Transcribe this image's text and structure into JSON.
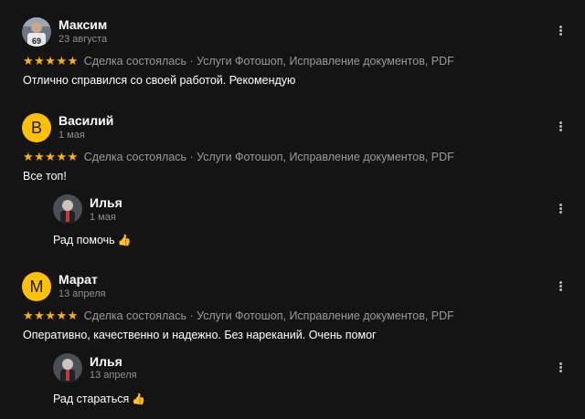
{
  "reviews": [
    {
      "author": "Максим",
      "date": "23 августа",
      "stars": "★★★★★",
      "rating": 5,
      "meta": "Сделка состоялась · Услуги Фотошоп, Исправление документов, PDF",
      "text": "Отлично справился со своей работой. Рекомендую"
    },
    {
      "author": "Василий",
      "avatar_letter": "В",
      "date": "1 мая",
      "stars": "★★★★★",
      "rating": 5,
      "meta": "Сделка состоялась · Услуги Фотошоп, Исправление документов, PDF",
      "text": "Все топ!",
      "reply": {
        "author": "Илья",
        "date": "1 мая",
        "text": "Рад помочь",
        "emoji": "👍"
      }
    },
    {
      "author": "Марат",
      "avatar_letter": "М",
      "date": "13 апреля",
      "stars": "★★★★★",
      "rating": 5,
      "meta": "Сделка состоялась · Услуги Фотошоп, Исправление документов, PDF",
      "text": "Оперативно, качественно и надежно. Без нареканий. Очень помог",
      "reply": {
        "author": "Илья",
        "date": "13 апреля",
        "text": "Рад стараться",
        "emoji": "👍"
      }
    }
  ],
  "colors": {
    "background": "#141414",
    "star": "#ffb300",
    "avatar_letter_bg": "#ffc107",
    "muted_text": "#8f8f8f"
  },
  "icons": {
    "menu": "more-vertical-icon",
    "like": "thumbs-up-icon"
  }
}
